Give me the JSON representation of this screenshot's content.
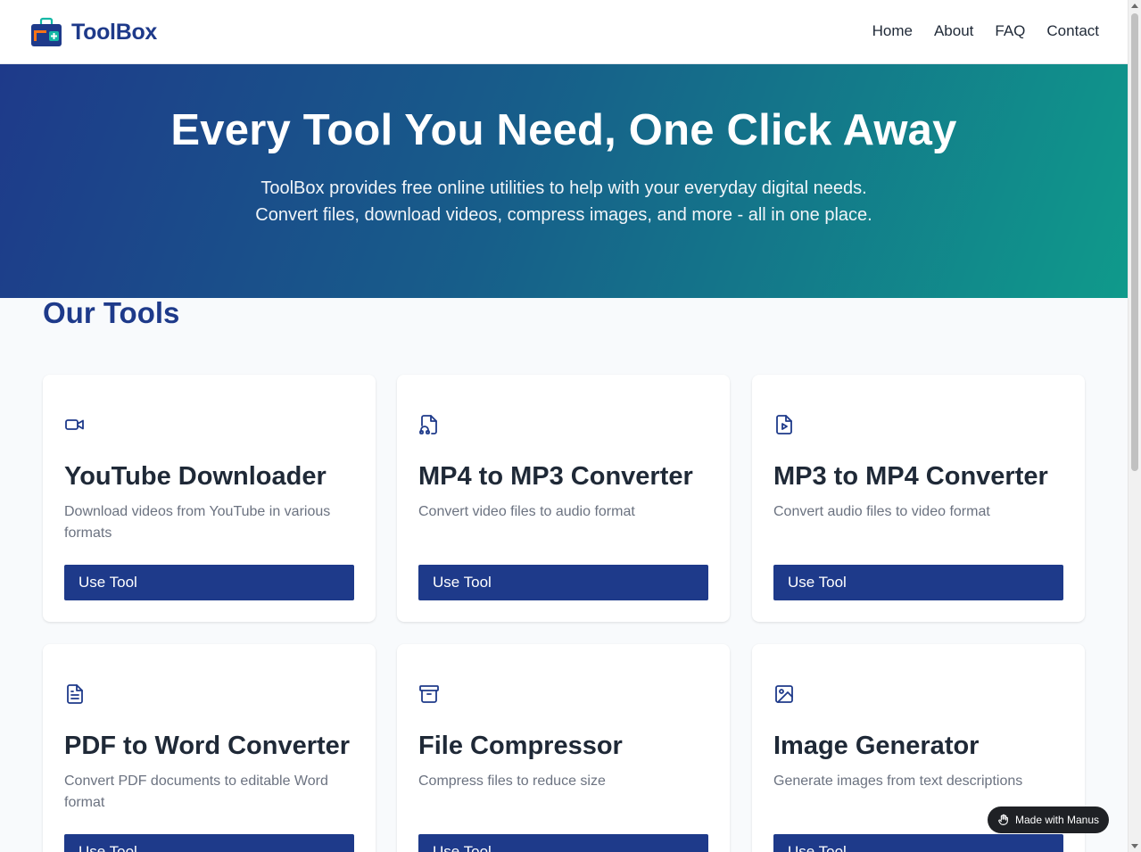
{
  "header": {
    "logo_text": "ToolBox",
    "nav": [
      {
        "label": "Home"
      },
      {
        "label": "About"
      },
      {
        "label": "FAQ"
      },
      {
        "label": "Contact"
      }
    ]
  },
  "hero": {
    "title": "Every Tool You Need, One Click Away",
    "subtitle_line1": "ToolBox provides free online utilities to help with your everyday digital needs.",
    "subtitle_line2": "Convert files, download videos, compress images, and more - all in one place."
  },
  "tools_section": {
    "title": "Our Tools",
    "cards": [
      {
        "icon": "video-camera-icon",
        "title": "YouTube Downloader",
        "description": "Download videos from YouTube in various formats",
        "button_label": "Use Tool"
      },
      {
        "icon": "file-audio-icon",
        "title": "MP4 to MP3 Converter",
        "description": "Convert video files to audio format",
        "button_label": "Use Tool"
      },
      {
        "icon": "file-video-icon",
        "title": "MP3 to MP4 Converter",
        "description": "Convert audio files to video format",
        "button_label": "Use Tool"
      },
      {
        "icon": "document-icon",
        "title": "PDF to Word Converter",
        "description": "Convert PDF documents to editable Word format",
        "button_label": "Use Tool"
      },
      {
        "icon": "archive-icon",
        "title": "File Compressor",
        "description": "Compress files to reduce size",
        "button_label": "Use Tool"
      },
      {
        "icon": "image-icon",
        "title": "Image Generator",
        "description": "Generate images from text descriptions",
        "button_label": "Use Tool"
      }
    ]
  },
  "badge": {
    "label": "Made with Manus",
    "icon": "manus-hand-icon"
  },
  "colors": {
    "brand": "#1e3a8a",
    "hero_gradient_start": "#1e3a8a",
    "hero_gradient_end": "#0f9a8b",
    "button": "#1e3a8a"
  }
}
